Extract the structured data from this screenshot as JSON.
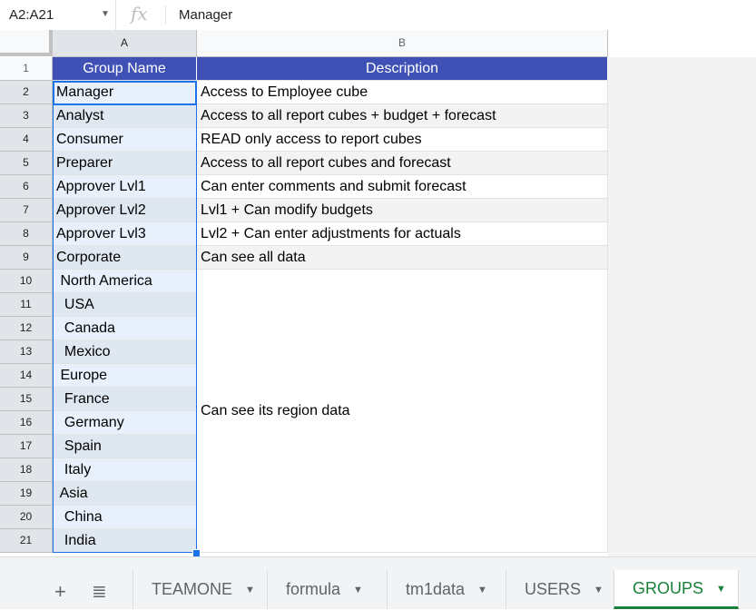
{
  "formula_bar": {
    "name_box": "A2:A21",
    "fx_icon": "fx",
    "value": "Manager"
  },
  "columns": [
    "A",
    "B"
  ],
  "rows": [
    "1",
    "2",
    "3",
    "4",
    "5",
    "6",
    "7",
    "8",
    "9",
    "10",
    "11",
    "12",
    "13",
    "14",
    "15",
    "16",
    "17",
    "18",
    "19",
    "20",
    "21"
  ],
  "header": {
    "group": "Group Name",
    "description": "Description"
  },
  "groups": [
    "Manager",
    "Analyst",
    "Consumer",
    "Preparer",
    "Approver Lvl1",
    "Approver Lvl2",
    "Approver Lvl3",
    "Corporate",
    " North America",
    "  USA",
    "  Canada",
    "  Mexico",
    " Europe",
    "  France",
    "  Germany",
    "  Spain",
    "  Italy",
    " Asia",
    "  China",
    "  India"
  ],
  "descriptions": [
    "Access to Employee cube",
    "Access to all report cubes + budget + forecast",
    "READ only access to report cubes",
    "Access to all report cubes and forecast",
    "Can enter comments and submit forecast",
    "Lvl1 + Can modify budgets",
    "Lvl2 + Can enter adjustments for actuals",
    "Can see all data"
  ],
  "merged_description": "Can see its region data",
  "sheet_tabs": [
    {
      "label": "TEAMONE",
      "active": false
    },
    {
      "label": "formula",
      "active": false
    },
    {
      "label": "tm1data",
      "active": false
    },
    {
      "label": "USERS",
      "active": false
    },
    {
      "label": "GROUPS",
      "active": true
    }
  ],
  "colors": {
    "header_bg": "#3f51b5",
    "selection": "#1a73e8",
    "active_tab": "#188038"
  }
}
